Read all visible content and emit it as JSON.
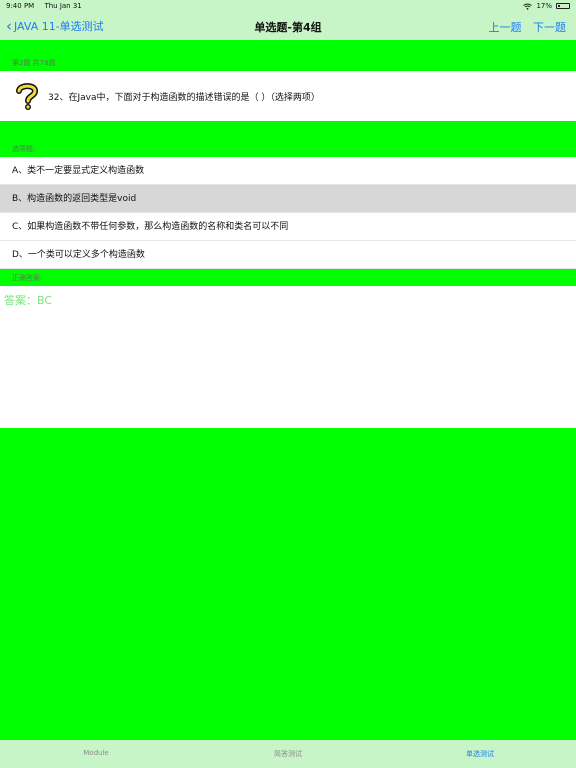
{
  "status": {
    "time": "9:40 PM",
    "date": "Thu Jan 31",
    "battery": "17%",
    "battery_level": 0.17
  },
  "nav": {
    "back_label": "JAVA 11-单选测试",
    "title": "单选题-第4组",
    "prev_label": "上一题",
    "next_label": "下一题"
  },
  "question": {
    "section_label": "第2题 共78题",
    "text": "32、在Java中，下面对于构造函数的描述错误的是（  ）（选择两项）"
  },
  "options": {
    "section_label": "选项框:",
    "items": [
      {
        "label": "A、类不一定要显式定义构造函数"
      },
      {
        "label": "B、构造函数的返回类型是void"
      },
      {
        "label": "C、如果构造函数不带任何参数，那么构造函数的名称和类名可以不同"
      },
      {
        "label": "D、一个类可以定义多个构造函数"
      }
    ],
    "selected_index": 1
  },
  "answer": {
    "section_label": "正确答案:",
    "text": "答案：BC"
  },
  "tabs": [
    {
      "label": "Module"
    },
    {
      "label": "简答测试"
    },
    {
      "label": "单选测试"
    }
  ],
  "colors": {
    "accent": "#1e7cf2",
    "background": "#00ff00",
    "bars": "#c8f5c8",
    "answer": "#7ee07e"
  },
  "icons": {
    "question": "question-mark-icon",
    "back": "chevron-left-icon",
    "wifi": "wifi-icon",
    "battery": "battery-icon"
  }
}
